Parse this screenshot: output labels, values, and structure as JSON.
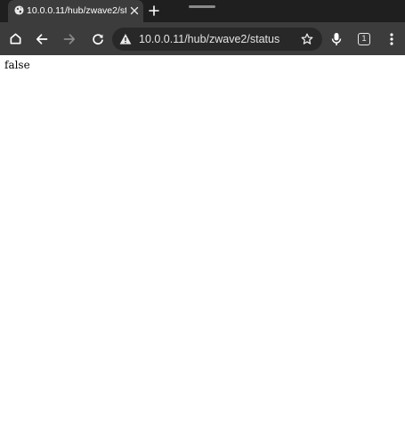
{
  "tab": {
    "title": "10.0.0.11/hub/zwave2/status",
    "favicon_icon": "globe-icon",
    "close_icon": "close-icon"
  },
  "tabstrip": {
    "new_tab_icon": "plus-icon",
    "drag_handle_icon": "drag-handle-icon"
  },
  "toolbar": {
    "home_icon": "home-icon",
    "back_icon": "back-arrow-icon",
    "forward_icon": "forward-arrow-icon",
    "reload_icon": "reload-icon",
    "mic_icon": "mic-icon",
    "tab_count": "1",
    "menu_icon": "more-vert-icon"
  },
  "omnibox": {
    "security_icon": "not-secure-warning-icon",
    "url": "10.0.0.11/hub/zwave2/status",
    "bookmark_icon": "star-icon"
  },
  "page": {
    "body_text": "false"
  },
  "colors": {
    "tabstrip_bg": "#1f1f1f",
    "toolbar_bg": "#3c3c3c",
    "omnibox_bg": "#282828",
    "page_bg": "#ffffff"
  }
}
